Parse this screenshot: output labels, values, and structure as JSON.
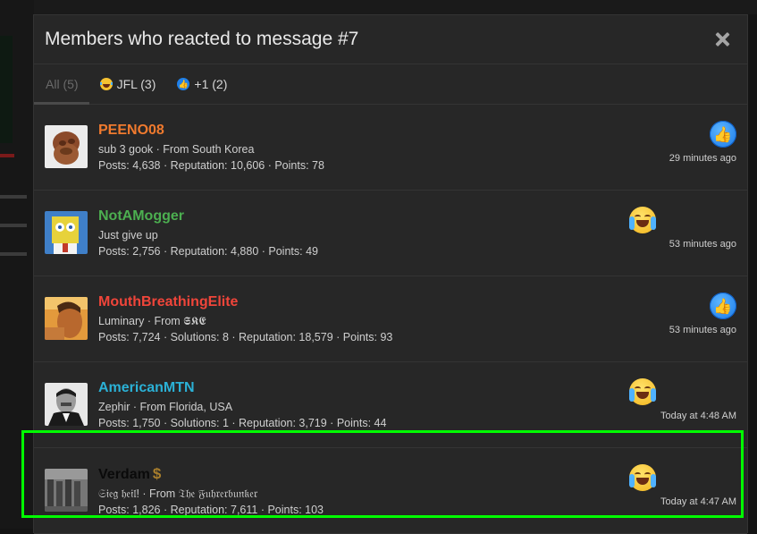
{
  "modal": {
    "title": "Members who reacted to message #7"
  },
  "tabs": [
    {
      "label": "All (5)",
      "icon": ""
    },
    {
      "label": "JFL (3)",
      "icon": "crying-laughing-icon"
    },
    {
      "label": "+1 (2)",
      "icon": "thumbs-up-icon"
    }
  ],
  "members": [
    {
      "name": "PEENO08",
      "name_color": "#f07a2e",
      "line2": "sub 3 gook · From South Korea",
      "line3": "Posts: 4,638 · Reputation: 10,606 · Points: 78",
      "reaction": "thumbs-up-icon",
      "time": "29 minutes ago"
    },
    {
      "name": "NotAMogger",
      "name_color": "#4caf50",
      "line2": "Just give up",
      "line3": "Posts: 2,756 · Reputation: 4,880 · Points: 49",
      "reaction": "crying-laughing-icon",
      "time": "53 minutes ago"
    },
    {
      "name": "MouthBreathingElite",
      "name_color": "#f0453a",
      "line2": "Luminary · From 𝕾𝕶𝕰",
      "line3": "Posts: 7,724 · Solutions: 8 · Reputation: 18,579 · Points: 93",
      "reaction": "thumbs-up-icon",
      "time": "53 minutes ago"
    },
    {
      "name": "AmericanMTN",
      "name_color": "#2bb1d6",
      "line2": "Zephir · From Florida, USA",
      "line3": "Posts: 1,750 · Solutions: 1 · Reputation: 3,719 · Points: 44",
      "reaction": "crying-laughing-icon",
      "time": "Today at 4:48 AM"
    },
    {
      "name": "Verdam",
      "name_color": "#0a0a0a",
      "badge": "$",
      "line2": "𝔖𝔦𝔢𝔤 𝔥𝔢𝔦𝔩! · From 𝔗𝔥𝔢 𝔉𝔲𝔥𝔯𝔢𝔯𝔟𝔲𝔫𝔨𝔢𝔯",
      "line3": "Posts: 1,826 · Reputation: 7,611 · Points: 103",
      "reaction": "crying-laughing-icon",
      "time": "Today at 4:47 AM"
    }
  ],
  "colors": {
    "highlight": "#00ff00",
    "modal_bg": "#272727",
    "thumb_blue": "#1877e6"
  }
}
